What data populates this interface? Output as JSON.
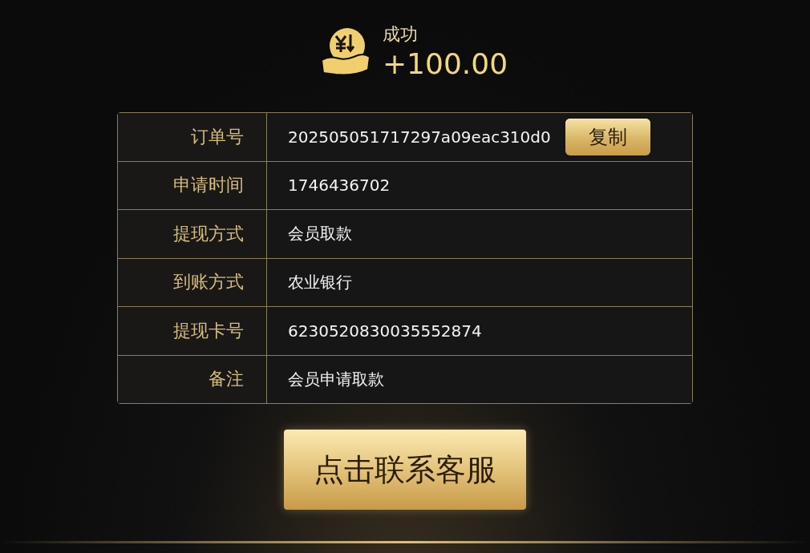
{
  "result": {
    "status": "成功",
    "amount": "+100.00"
  },
  "details": [
    {
      "label": "订单号",
      "value": "202505051717297a09eac310d0",
      "action": "复制"
    },
    {
      "label": "申请时间",
      "value": "1746436702"
    },
    {
      "label": "提现方式",
      "value": "会员取款"
    },
    {
      "label": "到账方式",
      "value": "农业银行"
    },
    {
      "label": "提现卡号",
      "value": "6230520830035552874"
    },
    {
      "label": "备注",
      "value": "会员申请取款"
    }
  ],
  "contact_button": "点击联系客服"
}
